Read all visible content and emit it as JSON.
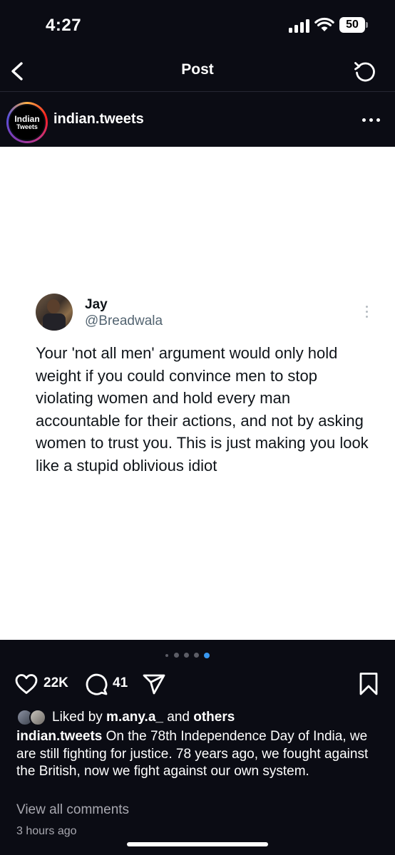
{
  "status_bar": {
    "time": "4:27",
    "battery": "50",
    "icons": [
      "signal-icon",
      "wifi-icon",
      "battery-icon"
    ]
  },
  "nav": {
    "title": "Post",
    "back_icon": "chevron-left-icon",
    "refresh_icon": "refresh-icon"
  },
  "post": {
    "username": "indian.tweets",
    "avatar_text_line1": "Indian",
    "avatar_text_line2": "Tweets",
    "more_icon": "more-horizontal-icon",
    "tweet": {
      "name": "Jay",
      "handle": "@Breadwala",
      "text": "Your 'not all men' argument would only hold weight if you could convince men to stop violating women and hold every man accountable for their actions, and not by asking women to trust you. This is just making you look like a stupid oblivious idiot"
    },
    "carousel": {
      "total_slides": 5,
      "active_index": 4,
      "active_color": "#3897f0"
    },
    "actions": {
      "like_count": "22K",
      "comment_count": "41",
      "icons": [
        "heart-icon",
        "comment-icon",
        "share-icon",
        "bookmark-icon"
      ]
    },
    "likes": {
      "prefix": "Liked by ",
      "user": "m.any.a_",
      "middle": " and ",
      "others": "others"
    },
    "caption": {
      "username": "indian.tweets",
      "text": " On the 78th Independence Day of India, we are still fighting for justice. 78 years ago, we fought against the British, now we fight against our own system."
    },
    "view_comments": "View all comments",
    "time_ago": "3 hours ago"
  }
}
